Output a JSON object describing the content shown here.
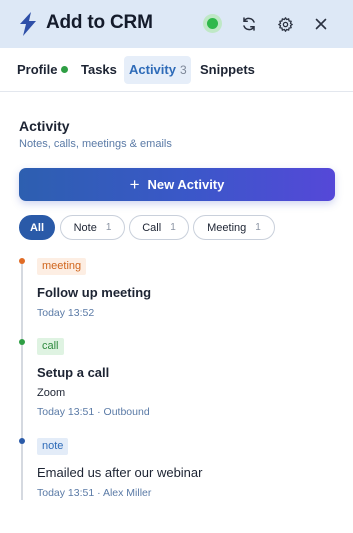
{
  "header": {
    "title": "Add to CRM",
    "logo_icon": "lightning-icon",
    "status_color": "#2fb84a",
    "refresh_icon": "refresh-icon",
    "settings_icon": "gear-icon",
    "close_icon": "close-icon"
  },
  "tabs": [
    {
      "label": "Profile",
      "indicator": "green-dot"
    },
    {
      "label": "Tasks"
    },
    {
      "label": "Activity",
      "count": "3",
      "active": true
    },
    {
      "label": "Snippets"
    }
  ],
  "section": {
    "title": "Activity",
    "subtitle": "Notes, calls, meetings & emails"
  },
  "new_activity": {
    "icon": "plus-icon",
    "label": "New Activity"
  },
  "filters": [
    {
      "label": "All",
      "active": true
    },
    {
      "label": "Note",
      "count": "1"
    },
    {
      "label": "Call",
      "count": "1"
    },
    {
      "label": "Meeting",
      "count": "1"
    }
  ],
  "activities": [
    {
      "type": "meeting",
      "color": "#e06b25",
      "title": "Follow up meeting",
      "meta": "Today 13:52"
    },
    {
      "type": "call",
      "color": "#2e9e44",
      "title": "Setup a call",
      "description": "Zoom",
      "meta": "Today 13:51 · Outbound"
    },
    {
      "type": "note",
      "color": "#2a5aa8",
      "title": "Emailed us after our webinar",
      "meta": "Today 13:51 · Alex Miller"
    }
  ],
  "colors": {
    "header_bg": "#dde8f6",
    "accent": "#2a5aa8",
    "button_gradient_start": "#2d5fb0",
    "button_gradient_end": "#5548d8"
  }
}
